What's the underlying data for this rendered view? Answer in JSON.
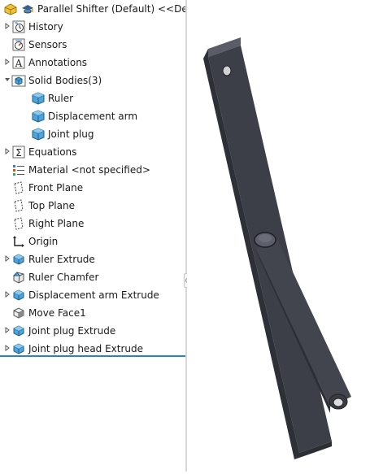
{
  "tree": {
    "root": "Parallel Shifter (Default) <<Defaul",
    "items": [
      {
        "label": "History",
        "icon": "history-icon",
        "expandable": true
      },
      {
        "label": "Sensors",
        "icon": "sensors-icon",
        "expandable": false
      },
      {
        "label": "Annotations",
        "icon": "annotations-icon",
        "expandable": true
      },
      {
        "label": "Solid Bodies(3)",
        "icon": "solid-bodies-folder-icon",
        "expandable": true,
        "expanded": true
      },
      {
        "label": "Ruler",
        "icon": "solid-body-icon",
        "child": true
      },
      {
        "label": "Displacement arm",
        "icon": "solid-body-icon",
        "child": true
      },
      {
        "label": "Joint plug",
        "icon": "solid-body-icon",
        "child": true
      },
      {
        "label": "Equations",
        "icon": "equations-icon",
        "expandable": true
      },
      {
        "label": "Material <not specified>",
        "icon": "material-icon",
        "expandable": false
      },
      {
        "label": "Front Plane",
        "icon": "plane-icon",
        "expandable": false
      },
      {
        "label": "Top Plane",
        "icon": "plane-icon",
        "expandable": false
      },
      {
        "label": "Right Plane",
        "icon": "plane-icon",
        "expandable": false
      },
      {
        "label": "Origin",
        "icon": "origin-icon",
        "expandable": false
      },
      {
        "label": "Ruler Extrude",
        "icon": "extrude-icon",
        "expandable": true
      },
      {
        "label": "Ruler Chamfer",
        "icon": "chamfer-icon",
        "expandable": false
      },
      {
        "label": "Displacement arm Extrude",
        "icon": "extrude-icon",
        "expandable": true
      },
      {
        "label": "Move Face1",
        "icon": "move-face-icon",
        "expandable": false
      },
      {
        "label": "Joint plug Extrude",
        "icon": "extrude-icon",
        "expandable": true
      },
      {
        "label": "Joint plug head Extrude",
        "icon": "extrude-icon",
        "expandable": true
      }
    ]
  },
  "colors": {
    "accent": "#2a7fd4",
    "body_fill": "#3d3f48",
    "body_top": "#5a5d68",
    "icon_blue": "#4fa3d9"
  }
}
